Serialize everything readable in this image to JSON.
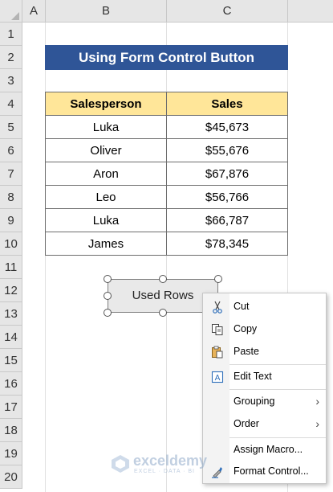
{
  "columns": [
    "A",
    "B",
    "C"
  ],
  "rows": [
    "1",
    "2",
    "3",
    "4",
    "5",
    "6",
    "7",
    "8",
    "9",
    "10",
    "11",
    "12",
    "13",
    "14",
    "15",
    "16",
    "17",
    "18",
    "19",
    "20"
  ],
  "title": "Using Form Control Button",
  "table": {
    "headers": [
      "Salesperson",
      "Sales"
    ],
    "rows": [
      [
        "Luka",
        "$45,673"
      ],
      [
        "Oliver",
        "$55,676"
      ],
      [
        "Aron",
        "$67,876"
      ],
      [
        "Leo",
        "$56,766"
      ],
      [
        "Luka",
        "$66,787"
      ],
      [
        "James",
        "$78,345"
      ]
    ]
  },
  "button": {
    "label": "Used Rows"
  },
  "context_menu": {
    "cut": "Cut",
    "copy": "Copy",
    "paste": "Paste",
    "edit_text": "Edit Text",
    "grouping": "Grouping",
    "order": "Order",
    "assign_macro": "Assign Macro...",
    "format_control": "Format Control..."
  },
  "watermark": {
    "name": "exceldemy",
    "tagline": "EXCEL · DATA · BI"
  },
  "colors": {
    "title_bg": "#2f5597",
    "header_bg": "#ffe699"
  }
}
